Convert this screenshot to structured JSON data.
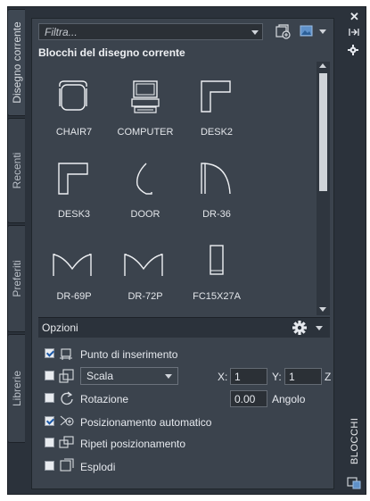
{
  "tabs": [
    {
      "label": "Disegno corrente",
      "active": true
    },
    {
      "label": "Recenti",
      "active": false
    },
    {
      "label": "Preferiti",
      "active": false
    },
    {
      "label": "Librerie",
      "active": false
    }
  ],
  "filter": {
    "placeholder": "Filtra..."
  },
  "section_title": "Blocchi del disegno corrente",
  "blocks": [
    {
      "name": "CHAIR7",
      "icon": "chair-icon"
    },
    {
      "name": "COMPUTER",
      "icon": "computer-icon"
    },
    {
      "name": "DESK2",
      "icon": "desk2-icon"
    },
    {
      "name": "DESK3",
      "icon": "desk3-icon"
    },
    {
      "name": "DOOR",
      "icon": "door-icon"
    },
    {
      "name": "DR-36",
      "icon": "dr36-icon"
    },
    {
      "name": "DR-69P",
      "icon": "dr69p-icon"
    },
    {
      "name": "DR-72P",
      "icon": "dr72p-icon"
    },
    {
      "name": "FC15X27A",
      "icon": "fc15x27a-icon"
    }
  ],
  "options": {
    "title": "Opzioni",
    "insertion_point": {
      "label": "Punto di inserimento",
      "checked": true
    },
    "scale": {
      "checked": false,
      "value": "Scala",
      "x_label": "X:",
      "x_value": "1",
      "y_label": "Y:",
      "y_value": "1",
      "z_label": "Z"
    },
    "rotation": {
      "label": "Rotazione",
      "checked": false,
      "angle_value": "0.00",
      "angle_label": "Angolo"
    },
    "auto_placement": {
      "label": "Posizionamento automatico",
      "checked": true
    },
    "repeat_placement": {
      "label": "Ripeti posizionamento",
      "checked": false
    },
    "explode": {
      "label": "Esplodi",
      "checked": false
    }
  },
  "palette_title": "BLOCCHI",
  "colors": {
    "accent": "#1e5aa8",
    "panel": "#3b434d",
    "frame": "#2b323b"
  }
}
